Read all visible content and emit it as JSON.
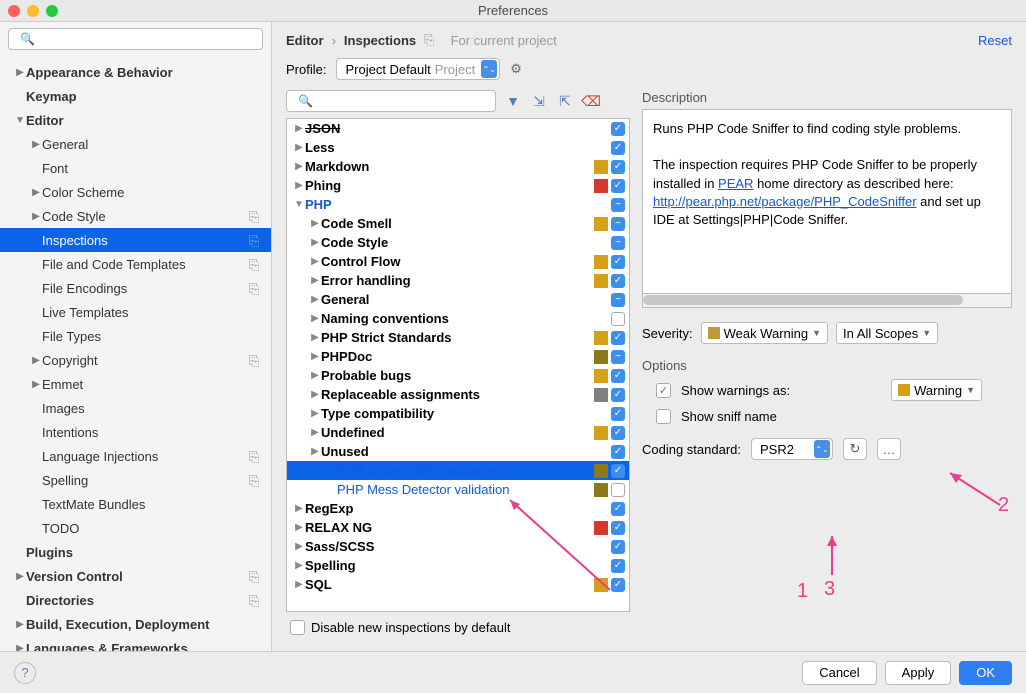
{
  "window": {
    "title": "Preferences"
  },
  "breadcrumb": {
    "a": "Editor",
    "b": "Inspections",
    "current": "For current project",
    "reset": "Reset"
  },
  "profile": {
    "label": "Profile:",
    "name": "Project Default",
    "suffix": "Project"
  },
  "sidebar": {
    "items": [
      {
        "label": "Appearance & Behavior",
        "bold": true,
        "caret": "right",
        "indent": 0
      },
      {
        "label": "Keymap",
        "bold": true,
        "indent": 0
      },
      {
        "label": "Editor",
        "bold": true,
        "caret": "down",
        "indent": 0
      },
      {
        "label": "General",
        "caret": "right",
        "indent": 1
      },
      {
        "label": "Font",
        "indent": 1
      },
      {
        "label": "Color Scheme",
        "caret": "right",
        "indent": 1
      },
      {
        "label": "Code Style",
        "caret": "right",
        "indent": 1,
        "copy": true
      },
      {
        "label": "Inspections",
        "indent": 1,
        "copy": true,
        "selected": true
      },
      {
        "label": "File and Code Templates",
        "indent": 1,
        "copy": true
      },
      {
        "label": "File Encodings",
        "indent": 1,
        "copy": true
      },
      {
        "label": "Live Templates",
        "indent": 1
      },
      {
        "label": "File Types",
        "indent": 1
      },
      {
        "label": "Copyright",
        "caret": "right",
        "indent": 1,
        "copy": true
      },
      {
        "label": "Emmet",
        "caret": "right",
        "indent": 1
      },
      {
        "label": "Images",
        "indent": 1
      },
      {
        "label": "Intentions",
        "indent": 1
      },
      {
        "label": "Language Injections",
        "indent": 1,
        "copy": true
      },
      {
        "label": "Spelling",
        "indent": 1,
        "copy": true
      },
      {
        "label": "TextMate Bundles",
        "indent": 1
      },
      {
        "label": "TODO",
        "indent": 1
      },
      {
        "label": "Plugins",
        "bold": true,
        "indent": 0
      },
      {
        "label": "Version Control",
        "bold": true,
        "caret": "right",
        "indent": 0,
        "copy": true
      },
      {
        "label": "Directories",
        "bold": true,
        "indent": 0,
        "copy": true
      },
      {
        "label": "Build, Execution, Deployment",
        "bold": true,
        "caret": "right",
        "indent": 0
      },
      {
        "label": "Languages & Frameworks",
        "bold": true,
        "caret": "right",
        "indent": 0
      }
    ]
  },
  "inspections": [
    {
      "name": "JSON",
      "caret": "right",
      "ind": 0,
      "cb": "on",
      "strike": true
    },
    {
      "name": "Less",
      "caret": "right",
      "ind": 0,
      "cb": "on"
    },
    {
      "name": "Markdown",
      "caret": "right",
      "ind": 0,
      "sq": "#d4a018",
      "cb": "on"
    },
    {
      "name": "Phing",
      "caret": "right",
      "ind": 0,
      "sq": "#d43a2f",
      "cb": "on"
    },
    {
      "name": "PHP",
      "caret": "down",
      "ind": 0,
      "cb": "minus",
      "php": true
    },
    {
      "name": "Code Smell",
      "caret": "right",
      "ind": 1,
      "sq": "#d4a018",
      "cb": "minus"
    },
    {
      "name": "Code Style",
      "caret": "right",
      "ind": 1,
      "cb": "minus"
    },
    {
      "name": "Control Flow",
      "caret": "right",
      "ind": 1,
      "sq": "#d4a018",
      "cb": "on"
    },
    {
      "name": "Error handling",
      "caret": "right",
      "ind": 1,
      "sq": "#d4a018",
      "cb": "on"
    },
    {
      "name": "General",
      "caret": "right",
      "ind": 1,
      "cb": "minus"
    },
    {
      "name": "Naming conventions",
      "caret": "right",
      "ind": 1,
      "cb": "off"
    },
    {
      "name": "PHP Strict Standards",
      "caret": "right",
      "ind": 1,
      "sq": "#d4a018",
      "cb": "on"
    },
    {
      "name": "PHPDoc",
      "caret": "right",
      "ind": 1,
      "sq": "#8c7a18",
      "cb": "minus"
    },
    {
      "name": "Probable bugs",
      "caret": "right",
      "ind": 1,
      "sq": "#d4a018",
      "cb": "on"
    },
    {
      "name": "Replaceable assignments",
      "caret": "right",
      "ind": 1,
      "sq": "#808080",
      "cb": "on"
    },
    {
      "name": "Type compatibility",
      "caret": "right",
      "ind": 1,
      "cb": "on"
    },
    {
      "name": "Undefined",
      "caret": "right",
      "ind": 1,
      "sq": "#d4a018",
      "cb": "on"
    },
    {
      "name": "Unused",
      "caret": "right",
      "ind": 1,
      "cb": "on"
    },
    {
      "name": "PHP Code Sniffer validation",
      "ind": 2,
      "sq": "#8c7a18",
      "cb": "on",
      "sel": true,
      "child": true
    },
    {
      "name": "PHP Mess Detector validation",
      "ind": 2,
      "sq": "#8c7a18",
      "cb": "off",
      "child": true
    },
    {
      "name": "RegExp",
      "caret": "right",
      "ind": 0,
      "cb": "on"
    },
    {
      "name": "RELAX NG",
      "caret": "right",
      "ind": 0,
      "sq": "#d43a2f",
      "cb": "on"
    },
    {
      "name": "Sass/SCSS",
      "caret": "right",
      "ind": 0,
      "cb": "on"
    },
    {
      "name": "Spelling",
      "caret": "right",
      "ind": 0,
      "cb": "on"
    },
    {
      "name": "SQL",
      "caret": "right",
      "ind": 0,
      "sq": "#d4a018",
      "cb": "on"
    }
  ],
  "disable_new": "Disable new inspections by default",
  "description": {
    "label": "Description",
    "p1": "Runs PHP Code Sniffer to find coding style problems.",
    "p2a": "The inspection requires PHP Code Sniffer to be properly installed in ",
    "pear": "PEAR",
    "p2b": " home directory as described here: ",
    "link": "http://pear.php.net/package/PHP_CodeSniffer",
    "p2c": " and set up IDE at Settings|PHP|Code Sniffer."
  },
  "severity": {
    "label": "Severity:",
    "value": "Weak Warning",
    "scope": "In All Scopes"
  },
  "options": {
    "label": "Options",
    "show_warnings": "Show warnings as:",
    "warning_level": "Warning",
    "show_sniff": "Show sniff name",
    "coding_std_label": "Coding standard:",
    "coding_std": "PSR2"
  },
  "buttons": {
    "cancel": "Cancel",
    "apply": "Apply",
    "ok": "OK"
  },
  "annotations": {
    "a1": "1",
    "a2": "2",
    "a3": "3"
  },
  "colors": {
    "weak": "#bf9a3c",
    "warning": "#d4a018"
  }
}
